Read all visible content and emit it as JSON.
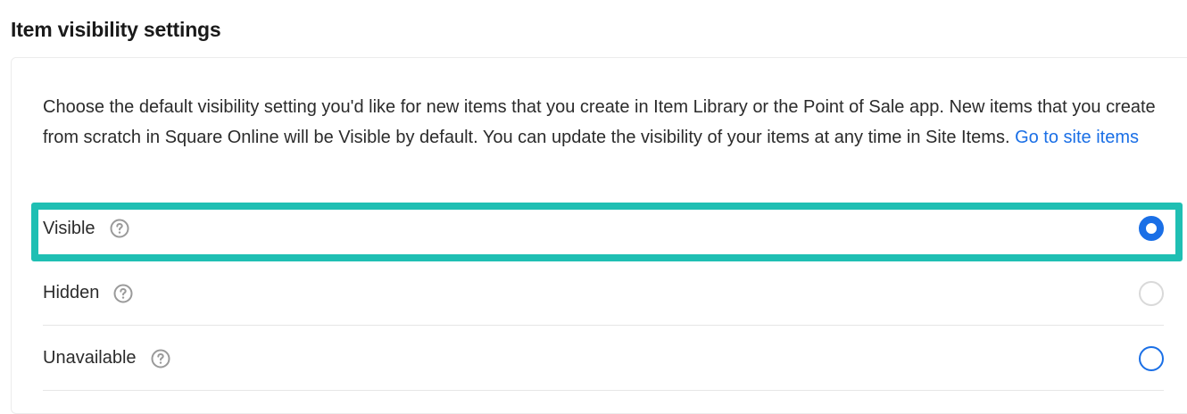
{
  "section": {
    "title": "Item visibility settings"
  },
  "description": {
    "text": "Choose the default visibility setting you'd like for new items that you create in Item Library or the Point of Sale app. New items that you create from scratch in Square Online will be Visible by default. You can update the visibility of your items at any time in Site Items.",
    "link_label": "Go to site items"
  },
  "options": [
    {
      "label": "Visible",
      "selected": true
    },
    {
      "label": "Hidden",
      "selected": false
    },
    {
      "label": "Unavailable",
      "selected": false
    }
  ],
  "colors": {
    "accent": "#1a6fe6",
    "highlight": "#1fbfb3"
  },
  "icons": {
    "help": "question-circle-icon"
  }
}
